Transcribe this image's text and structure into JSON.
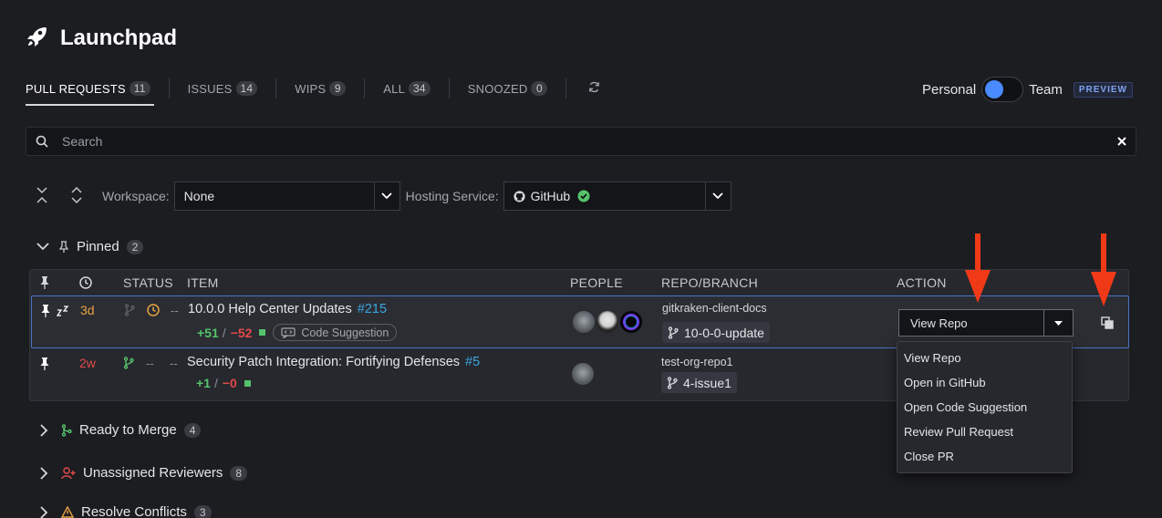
{
  "app": {
    "title": "Launchpad",
    "icon": "rocket-icon"
  },
  "tabs": [
    {
      "label": "PULL REQUESTS",
      "count": "11",
      "active": true
    },
    {
      "label": "ISSUES",
      "count": "14"
    },
    {
      "label": "WIPS",
      "count": "9"
    },
    {
      "label": "ALL",
      "count": "34"
    },
    {
      "label": "SNOOZED",
      "count": "0"
    }
  ],
  "toggle": {
    "left_label": "Personal",
    "right_label": "Team",
    "badge": "PREVIEW"
  },
  "search": {
    "placeholder": "Search"
  },
  "filters": {
    "workspace_label": "Workspace:",
    "workspace_value": "None",
    "hosting_label": "Hosting Service:",
    "hosting_value": "GitHub"
  },
  "pinned": {
    "label": "Pinned",
    "count": "2"
  },
  "table": {
    "headers": {
      "status": "STATUS",
      "item": "ITEM",
      "people": "PEOPLE",
      "repo": "REPO/BRANCH",
      "action": "ACTION"
    },
    "rows": [
      {
        "age": "3d",
        "status_dash": "--",
        "title": "10.0.0 Help Center Updates",
        "number": "#215",
        "additions": "+51",
        "slash": "/",
        "deletions": "−52",
        "chip": "Code Suggestion",
        "repo": "gitkraken-client-docs",
        "branch": "10-0-0-update",
        "action": "View Repo"
      },
      {
        "age": "2w",
        "status_dash_1": "--",
        "status_dash_2": "--",
        "title": "Security Patch Integration: Fortifying Defenses",
        "number": "#5",
        "additions": "+1",
        "slash": "/",
        "deletions": "−0",
        "repo": "test-org-repo1",
        "branch": "4-issue1"
      }
    ]
  },
  "action_menu": [
    "View Repo",
    "Open in GitHub",
    "Open Code Suggestion",
    "Review Pull Request",
    "Close PR"
  ],
  "groups": [
    {
      "label": "Ready to Merge",
      "count": "4"
    },
    {
      "label": "Unassigned Reviewers",
      "count": "8"
    },
    {
      "label": "Resolve Conflicts",
      "count": "3"
    }
  ],
  "colors": {
    "background": "#1c1d21",
    "accent_blue": "#4a8cff",
    "link": "#3aa8e0",
    "added": "#55c26b",
    "deleted": "#e24a4a",
    "warning": "#e8a341",
    "annotation_arrow": "#f03a17"
  }
}
